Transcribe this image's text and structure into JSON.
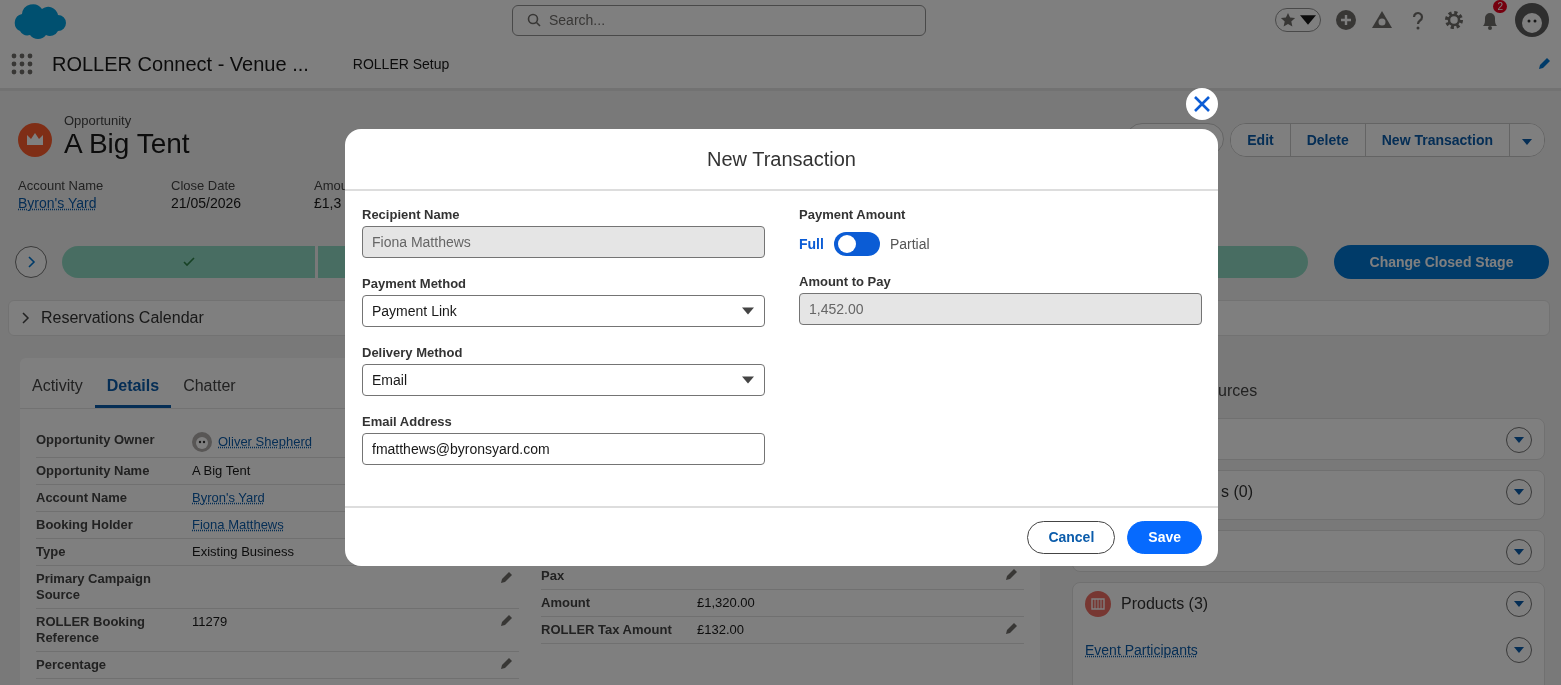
{
  "header": {
    "search": {
      "placeholder": "Search..."
    },
    "notifications": {
      "badge": "2"
    }
  },
  "nav": {
    "app_name": "ROLLER Connect - Venue ...",
    "tabs": [
      "ROLLER Setup"
    ]
  },
  "record": {
    "object_type": "Opportunity",
    "name": "A Big Tent",
    "actions": [
      "Edit",
      "Delete",
      "New Transaction"
    ],
    "highlights": [
      {
        "label": "Account Name",
        "value": "Byron's Yard",
        "kind": "link"
      },
      {
        "label": "Close Date",
        "value": "21/05/2026",
        "kind": "text"
      },
      {
        "label": "Amou",
        "value": "£1,3",
        "kind": "text"
      }
    ]
  },
  "path": {
    "button": "Change Closed Stage"
  },
  "reservations_calendar": {
    "title": "Reservations Calendar",
    "expanded": false
  },
  "details": {
    "tabs": [
      {
        "label": "Activity",
        "selected": false
      },
      {
        "label": "Details",
        "selected": true
      },
      {
        "label": "Chatter",
        "selected": false
      }
    ],
    "left_fields": [
      {
        "label": "Opportunity Owner",
        "value": "Oliver Shepherd",
        "kind": "user"
      },
      {
        "label": "Opportunity Name",
        "value": "A Big Tent",
        "kind": "text"
      },
      {
        "label": "Account Name",
        "value": "Byron's Yard",
        "kind": "link"
      },
      {
        "label": "Booking Holder",
        "value": "Fiona Matthews",
        "kind": "link"
      },
      {
        "label": "Type",
        "value": "Existing Business",
        "kind": "text"
      },
      {
        "label": "Primary Campaign Source",
        "editable": true
      },
      {
        "label": "ROLLER Booking Reference",
        "value": "11279",
        "kind": "text",
        "editable": true
      },
      {
        "label": "Percentage",
        "editable": true
      }
    ],
    "right_fields": [
      {
        "label": "Pax",
        "editable": true
      },
      {
        "label": "Amount",
        "value": "£1,320.00",
        "editable": false
      },
      {
        "label": "ROLLER Tax Amount",
        "value": "£132.00",
        "editable": true
      }
    ]
  },
  "related": {
    "heading": "urces",
    "lists": [
      {
        "kind": "plain"
      },
      {
        "kind": "plain",
        "title": "s (0)"
      },
      {
        "kind": "plain"
      },
      {
        "kind": "products",
        "title": "Products (3)",
        "items": [
          {
            "name": "Event Participants"
          }
        ]
      }
    ]
  },
  "modal": {
    "title": "New Transaction",
    "left_fields": [
      {
        "kind": "input",
        "label": "Recipient Name",
        "value": "Fiona Matthews",
        "disabled": true
      },
      {
        "kind": "select",
        "label": "Payment Method",
        "value": "Payment Link"
      },
      {
        "kind": "select",
        "label": "Delivery Method",
        "value": "Email"
      },
      {
        "kind": "input",
        "label": "Email Address",
        "value": "fmatthews@byronsyard.com",
        "disabled": false
      }
    ],
    "right_fields": [
      {
        "kind": "toggle",
        "label": "Payment Amount",
        "options": [
          {
            "label": "Full",
            "selected": true
          },
          {
            "label": "Partial",
            "selected": false
          }
        ]
      },
      {
        "kind": "input",
        "label": "Amount to Pay",
        "value": "1,452.00",
        "disabled": true
      }
    ],
    "buttons": [
      {
        "label": "Cancel",
        "kind": "neutral"
      },
      {
        "label": "Save",
        "kind": "brand"
      }
    ]
  }
}
